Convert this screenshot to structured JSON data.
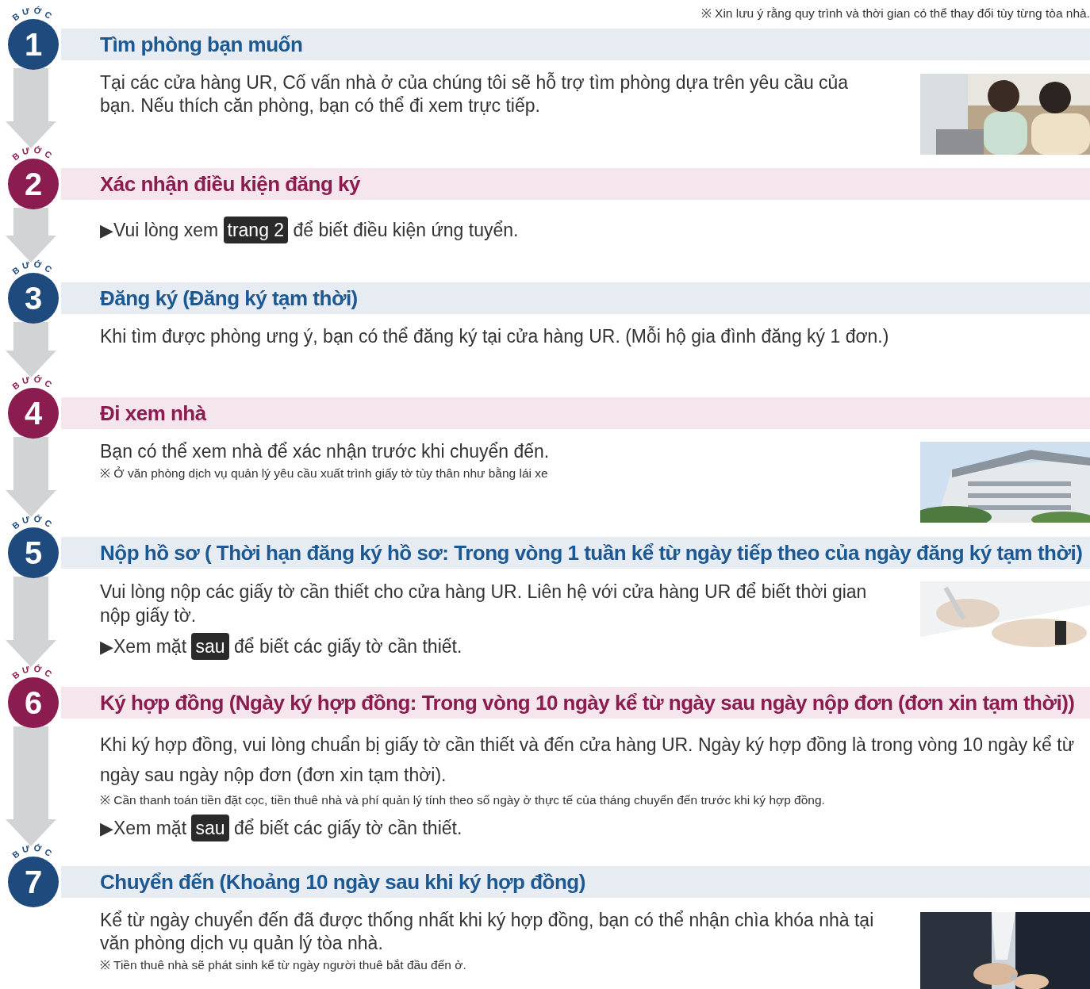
{
  "notice": "※ Xin lưu ý rằng quy trình và thời gian có thể thay đổi tùy từng tòa nhà.",
  "steps": [
    {
      "label": "BƯỚC",
      "number": "1",
      "kind": "blue",
      "title": "Tìm phòng bạn muốn",
      "picture": true,
      "body": [
        {
          "kind": "text",
          "text": "Tại các cửa hàng UR, Cố vấn nhà ở của chúng tôi sẽ hỗ trợ tìm phòng dựa trên yêu cầu của bạn. Nếu thích căn phòng, bạn có thể đi xem trực tiếp."
        }
      ]
    },
    {
      "label": "BƯỚC",
      "number": "2",
      "kind": "magenta",
      "title": "Xác nhận điều kiện đăng ký",
      "picture": false,
      "body": [
        {
          "kind": "link",
          "marker": "▶",
          "before": "Vui lòng xem",
          "badge": "trang 2",
          "after": "để biết điều kiện ứng tuyển."
        }
      ]
    },
    {
      "label": "BƯỚC",
      "number": "3",
      "kind": "blue",
      "title": "Đăng ký (Đăng ký tạm thời)",
      "picture": false,
      "body": [
        {
          "kind": "text",
          "text": "Khi tìm được phòng ưng ý, bạn có thể đăng ký tại cửa hàng UR. (Mỗi hộ gia đình đăng ký 1 đơn.)"
        }
      ]
    },
    {
      "label": "BƯỚC",
      "number": "4",
      "kind": "magenta",
      "title": "Đi xem nhà",
      "picture": true,
      "body": [
        {
          "kind": "text",
          "text": "Bạn có thể xem nhà để xác nhận trước khi chuyển đến."
        },
        {
          "kind": "note",
          "text": "※ Ở văn phòng dịch vụ quản lý yêu cầu xuất trình giấy tờ tùy thân như bằng lái xe"
        }
      ]
    },
    {
      "label": "BƯỚC",
      "number": "5",
      "kind": "blue",
      "title": "Nộp hồ sơ ( Thời hạn đăng ký hồ sơ: Trong vòng 1 tuần kể từ ngày tiếp theo của ngày đăng ký tạm thời)",
      "picture": true,
      "body": [
        {
          "kind": "text",
          "text": "Vui lòng nộp các giấy tờ cần thiết cho cửa hàng UR. Liên hệ với cửa hàng UR để biết thời gian nộp giấy tờ."
        },
        {
          "kind": "link",
          "marker": "▶",
          "before": "Xem mặt",
          "badge": "sau",
          "after": "để biết các giấy tờ cần thiết."
        }
      ]
    },
    {
      "label": "BƯỚC",
      "number": "6",
      "kind": "magenta",
      "title": "Ký hợp đồng (Ngày ký hợp đồng: Trong vòng 10 ngày kể từ ngày sau ngày nộp đơn (đơn xin tạm thời))",
      "picture": false,
      "body": [
        {
          "kind": "text",
          "text": "Khi ký hợp đồng, vui lòng chuẩn bị giấy tờ cần thiết và đến cửa hàng UR. Ngày ký hợp đồng là trong vòng 10 ngày kể từ ngày sau ngày nộp đơn (đơn xin tạm thời)."
        },
        {
          "kind": "note",
          "text": "※ Cần thanh toán tiền đặt cọc, tiền thuê nhà và phí quản lý tính theo số ngày ở thực tế của tháng chuyển đến trước khi ký hợp đồng."
        },
        {
          "kind": "link",
          "marker": "▶",
          "before": "Xem mặt",
          "badge": "sau",
          "after": "để biết các giấy tờ cần thiết."
        }
      ]
    },
    {
      "label": "BƯỚC",
      "number": "7",
      "kind": "blue",
      "title": "Chuyển đến (Khoảng 10 ngày sau khi ký hợp đồng)",
      "picture": true,
      "body": [
        {
          "kind": "text",
          "text": "Kể từ ngày chuyển đến đã được thống nhất khi ký hợp đồng, bạn có thể nhận chìa khóa nhà tại văn phòng dịch vụ quản lý tòa nhà."
        },
        {
          "kind": "note",
          "text": "※ Tiền thuê nhà sẽ phát sinh kể từ ngày người thuê bắt đầu đến ở."
        }
      ]
    }
  ]
}
